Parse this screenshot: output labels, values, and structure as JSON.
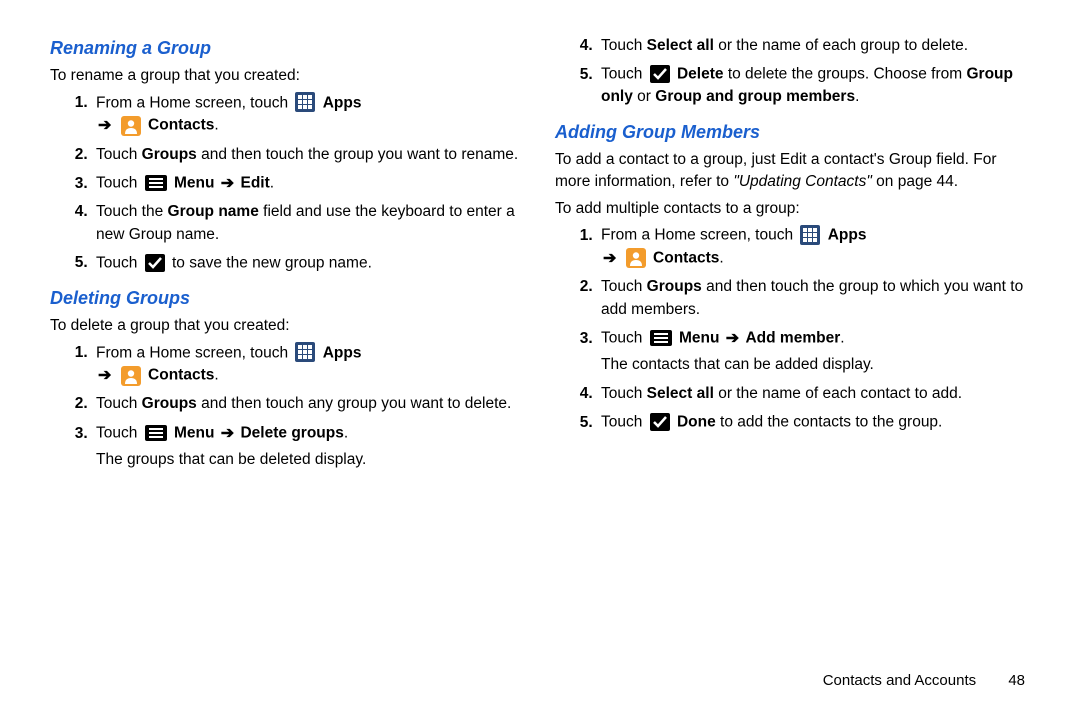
{
  "sections": {
    "renaming": {
      "heading": "Renaming a Group",
      "intro": "To rename a group that you created:",
      "s1_a": "From a Home screen, touch ",
      "apps": "Apps",
      "contacts": "Contacts",
      "s2_a": "Touch ",
      "s2_b": "Groups",
      "s2_c": " and then touch the group you want to rename.",
      "s3_a": "Touch ",
      "menu": "Menu",
      "edit": "Edit",
      "period": ".",
      "s4_a": "Touch the ",
      "s4_b": "Group name",
      "s4_c": " field and use the keyboard to enter a new Group name.",
      "s5_a": "Touch ",
      "s5_b": " to save the new group name."
    },
    "deleting": {
      "heading": "Deleting Groups",
      "intro": "To delete a group that you created:",
      "s1_a": "From a Home screen, touch ",
      "apps": "Apps",
      "contacts": "Contacts",
      "s2_a": "Touch ",
      "s2_b": "Groups",
      "s2_c": " and then touch any group you want to delete.",
      "s3_a": "Touch ",
      "menu": "Menu",
      "delgroups": "Delete groups",
      "period": ".",
      "s3_sub": "The groups that can be deleted display.",
      "s4_a": "Touch ",
      "s4_b": "Select all",
      "s4_c": " or the name of each group to delete.",
      "s5_a": "Touch ",
      "s5_b": "Delete",
      "s5_c": " to delete the groups. Choose from ",
      "s5_d": "Group only",
      "s5_e": " or ",
      "s5_f": "Group and group members",
      "s5_g": "."
    },
    "adding": {
      "heading": "Adding Group Members",
      "intro_a": "To add a contact to a group, just Edit a contact's Group field. For more information, refer to ",
      "intro_b": "\"Updating Contacts\"",
      "intro_c": " on page 44.",
      "intro2": "To add multiple contacts to a group:",
      "s1_a": "From a Home screen, touch ",
      "apps": "Apps",
      "contacts": "Contacts",
      "s2_a": "Touch ",
      "s2_b": "Groups",
      "s2_c": " and then touch the group to which you want to add members.",
      "s3_a": "Touch ",
      "menu": "Menu",
      "addmember": "Add member",
      "period": ".",
      "s3_sub": "The contacts that can be added display.",
      "s4_a": "Touch ",
      "s4_b": "Select all",
      "s4_c": " or the name of each contact to add.",
      "s5_a": "Touch ",
      "s5_b": "Done",
      "s5_c": " to add the contacts to the group."
    }
  },
  "arrow": "➔",
  "footer": {
    "section": "Contacts and Accounts",
    "page": "48"
  }
}
